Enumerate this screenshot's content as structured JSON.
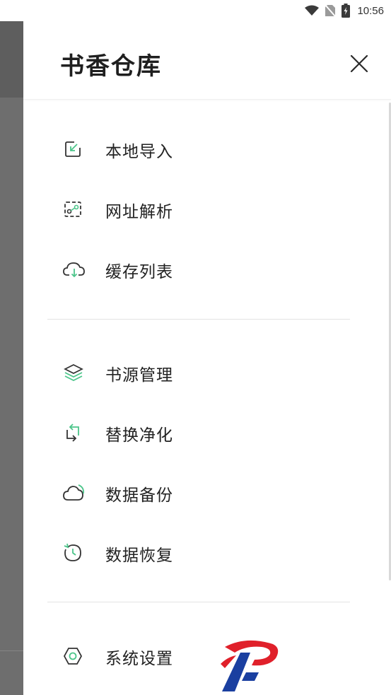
{
  "status_bar": {
    "time": "10:56",
    "icons": [
      "wifi-icon",
      "no-sim-icon",
      "battery-charging-icon"
    ]
  },
  "drawer": {
    "title": "书香仓库",
    "close_icon": "close-icon",
    "sections": [
      {
        "items": [
          {
            "label": "本地导入",
            "icon": "import-icon"
          },
          {
            "label": "网址解析",
            "icon": "url-parse-icon"
          },
          {
            "label": "缓存列表",
            "icon": "cloud-download-icon"
          }
        ]
      },
      {
        "items": [
          {
            "label": "书源管理",
            "icon": "layers-icon"
          },
          {
            "label": "替换净化",
            "icon": "swap-icon"
          },
          {
            "label": "数据备份",
            "icon": "cloud-backup-icon"
          },
          {
            "label": "数据恢复",
            "icon": "restore-clock-icon"
          }
        ]
      },
      {
        "items": [
          {
            "label": "系统设置",
            "icon": "settings-hexagon-icon"
          }
        ]
      }
    ]
  },
  "colors": {
    "accent_green": "#4cc58a",
    "icon_dark": "#333333",
    "scrim": "#6e6e6e",
    "logo_red": "#e0202a",
    "logo_blue": "#1a3fa0"
  }
}
